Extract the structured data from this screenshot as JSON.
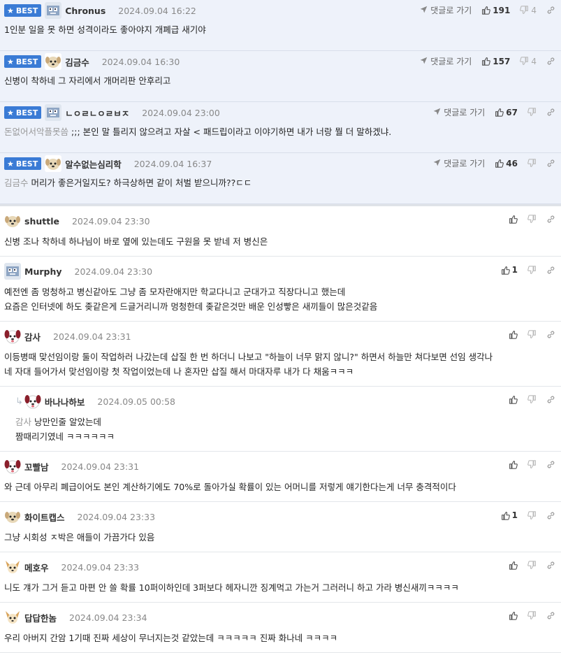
{
  "labels": {
    "best": "BEST",
    "reply_go": "댓글로 가기"
  },
  "best_comments": [
    {
      "nick": "Chronus",
      "date": "2024.09.04 16:22",
      "avatar": "robot-avatar",
      "ref": "",
      "text": "1인분 일을 못 하면 성격이라도 좋아야지 개폐급 새기야",
      "up": "191",
      "down": "4"
    },
    {
      "nick": "김금수",
      "date": "2024.09.04 16:30",
      "avatar": "puppy-avatar",
      "ref": "",
      "text": "신병이 착하네 그 자리에서 개머리판 안후리고",
      "up": "157",
      "down": "4"
    },
    {
      "nick": "ㄴㅇㄹㄴㅇㄹㅂㅈ",
      "date": "2024.09.04 23:00",
      "avatar": "robot-avatar",
      "ref": "돈없어서악플못씀",
      "text": ";;; 본인 말 틀리지 않으려고 자살 < 패드립이라고 이야기하면 내가 너랑 뭘 더 말하겠냐.",
      "up": "67",
      "down": ""
    },
    {
      "nick": "알수없는심리학",
      "date": "2024.09.04 16:37",
      "avatar": "puppy-avatar",
      "ref": "김금수",
      "text": "머리가 좋은거일지도? 하극상하면 같이 처벌 받으니까??ㄷㄷ",
      "up": "46",
      "down": ""
    }
  ],
  "comments": [
    {
      "nick": "shuttle",
      "date": "2024.09.04 23:30",
      "avatar": "puppy-avatar",
      "reply": false,
      "ref": "",
      "lines": [
        "신병 조나 착하네 하나님이 바로 옆에 있는데도 구원을 못 받네 저 병신은"
      ],
      "up": ""
    },
    {
      "nick": "Murphy",
      "date": "2024.09.04 23:30",
      "avatar": "robot-avatar",
      "reply": false,
      "ref": "",
      "lines": [
        "예전엔 좀 멍청하고 병신같아도 그냥 좀 모자란애지만 학교다니고 군대가고 직장다니고 했는데",
        "요즘은 인터넷에 하도 좆같은게 드글거리니까 멍청한데 좆같은것만 배운 인성빻은 새끼들이 많은것같음"
      ],
      "up": "1"
    },
    {
      "nick": "감사",
      "date": "2024.09.04 23:31",
      "avatar": "dog-red-avatar",
      "reply": false,
      "ref": "",
      "lines": [
        "이등병때 맞선임이랑 둘이 작업하러 나갔는데 삽질 한 번 하더니 나보고 \"하늘이 너무 맑지 않니?\" 하면서 하늘만 쳐다보면 선임 생각나",
        "네 자대 들어가서 맞선임이랑 첫 작업이었는데 나 혼자만 삽질 해서 마대자루 내가 다 채움ㅋㅋㅋ"
      ],
      "up": ""
    },
    {
      "nick": "바나나하보",
      "date": "2024.09.05 00:58",
      "avatar": "dog-red-avatar",
      "reply": true,
      "ref": "감사",
      "lines": [
        "낭만인줄 알았는데",
        "짬때리기였네 ㅋㅋㅋㅋㅋㅋ"
      ],
      "up": ""
    },
    {
      "nick": "꼬빨남",
      "date": "2024.09.04 23:31",
      "avatar": "dog-red-avatar",
      "reply": false,
      "ref": "",
      "lines": [
        "와 근데 아무리 폐급이어도 본인 계산하기에도 70%로 돌아가실 확률이 있는 어머니를 저렇게 얘기한다는게 너무 충격적이다"
      ],
      "up": ""
    },
    {
      "nick": "화이트캡스",
      "date": "2024.09.04 23:33",
      "avatar": "puppy-avatar",
      "reply": false,
      "ref": "",
      "lines": [
        "그냥 시회성 ㅈ박은 애들이 가끔가다 있음"
      ],
      "up": "1"
    },
    {
      "nick": "메호우",
      "date": "2024.09.04 23:33",
      "avatar": "chihuahua-avatar",
      "reply": false,
      "ref": "",
      "lines": [
        "니도 걔가 그거 듣고 마편 안 쓸 확률 10퍼이하인데 3퍼보다 헤자니깐 징계먹고 가는거 그러러니 하고 가라 병신새끼ㅋㅋㅋㅋ"
      ],
      "up": ""
    },
    {
      "nick": "답답한놈",
      "date": "2024.09.04 23:34",
      "avatar": "chihuahua-avatar",
      "reply": false,
      "ref": "",
      "lines": [
        "우리 아버지 간암 1기때 진짜 세상이 무너지는것 같았는데 ㅋㅋㅋㅋㅋ 진짜 화나네 ㅋㅋㅋㅋ"
      ],
      "up": ""
    }
  ]
}
